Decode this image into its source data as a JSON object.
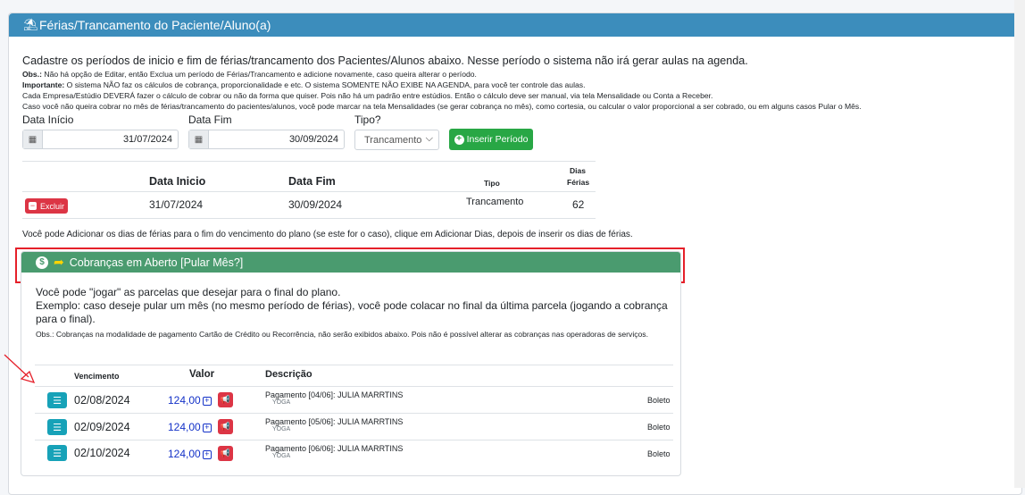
{
  "panel": {
    "title": "Férias/Trancamento do Paciente/Aluno(a)",
    "icon": "umbrella-beach-icon"
  },
  "intro": {
    "lead": "Cadastre os períodos de inicio e fim de férias/trancamento dos Pacientes/Alunos abaixo. Nesse período o sistema não irá gerar aulas na agenda.",
    "obs_label": "Obs.:",
    "obs_text": " Não há opção de Editar, então Exclua um período de Férias/Trancamento e adicione novamente, caso queira alterar o período.",
    "important_label": "Importante:",
    "important_text": " O sistema NÃO faz os cálculos de cobrança, proporcionalidade e etc. O sistema SOMENTE NÃO EXIBE NA AGENDA, para você ter controle das aulas.",
    "line3": "Cada Empresa/Estúdio DEVERÁ fazer o cálculo de cobrar ou não da forma que quiser. Pois não há um padrão entre estúdios. Então o cálculo deve ser manual, via tela Mensalidade ou Conta a Receber.",
    "line4": "Caso você não queira cobrar no mês de férias/trancamento do pacientes/alunos, você pode marcar na tela Mensalidades (se gerar cobrança no mês), como cortesia, ou calcular o valor proporcional a ser cobrado, ou em alguns casos Pular o Mês."
  },
  "form": {
    "start_label": "Data Início",
    "start_value": "31/07/2024",
    "end_label": "Data Fim",
    "end_value": "30/09/2024",
    "type_label": "Tipo?",
    "type_value": "Trancamento",
    "insert_button": "Inserir Período"
  },
  "periods": {
    "headers": {
      "start": "Data Inicio",
      "end": "Data Fim",
      "type": "Tipo",
      "days_line1": "Dias",
      "days_line2": "Férias"
    },
    "rows": [
      {
        "delete_label": "Excluir",
        "start": "31/07/2024",
        "end": "30/09/2024",
        "type": "Trancamento",
        "days": "62"
      }
    ]
  },
  "note": "Você pode Adicionar os dias de férias para o fim do vencimento do plano (se este for o caso), clique em Adicionar Dias, depois de inserir os dias de férias.",
  "charges": {
    "title": "Cobranças em Aberto [Pular Mês?]",
    "text1": "Você pode \"jogar\" as parcelas que desejar para o final do plano.",
    "text2": "Exemplo: caso deseje pular um mês (no mesmo período de férias), você pode colacar no final da última parcela (jogando a cobrança para o final).",
    "obs": "Obs.: Cobranças na modalidade de pagamento Cartão de Crédito ou Recorrência, não serão exibidos abaixo. Pois não é possível alterar as cobranças nas operadoras de serviços.",
    "headers": {
      "due": "Vencimento",
      "value": "Valor",
      "description": "Descrição"
    },
    "rows": [
      {
        "due": "02/08/2024",
        "value": "124,00",
        "description": "Pagamento [04/06]: JULIA MARRTINS",
        "modality": "YOGA",
        "method": "Boleto"
      },
      {
        "due": "02/09/2024",
        "value": "124,00",
        "description": "Pagamento [05/06]: JULIA MARRTINS",
        "modality": "YOGA",
        "method": "Boleto"
      },
      {
        "due": "02/10/2024",
        "value": "124,00",
        "description": "Pagamento [06/06]: JULIA MARRTINS",
        "modality": "YOGA",
        "method": "Boleto"
      }
    ]
  },
  "colors": {
    "header_blue": "#3c8dbc",
    "sub_header_green": "#4a9b6f",
    "success_green": "#28a745",
    "danger_red": "#dc3545",
    "info_teal": "#17a2b8",
    "highlight_red": "#e5202a"
  }
}
